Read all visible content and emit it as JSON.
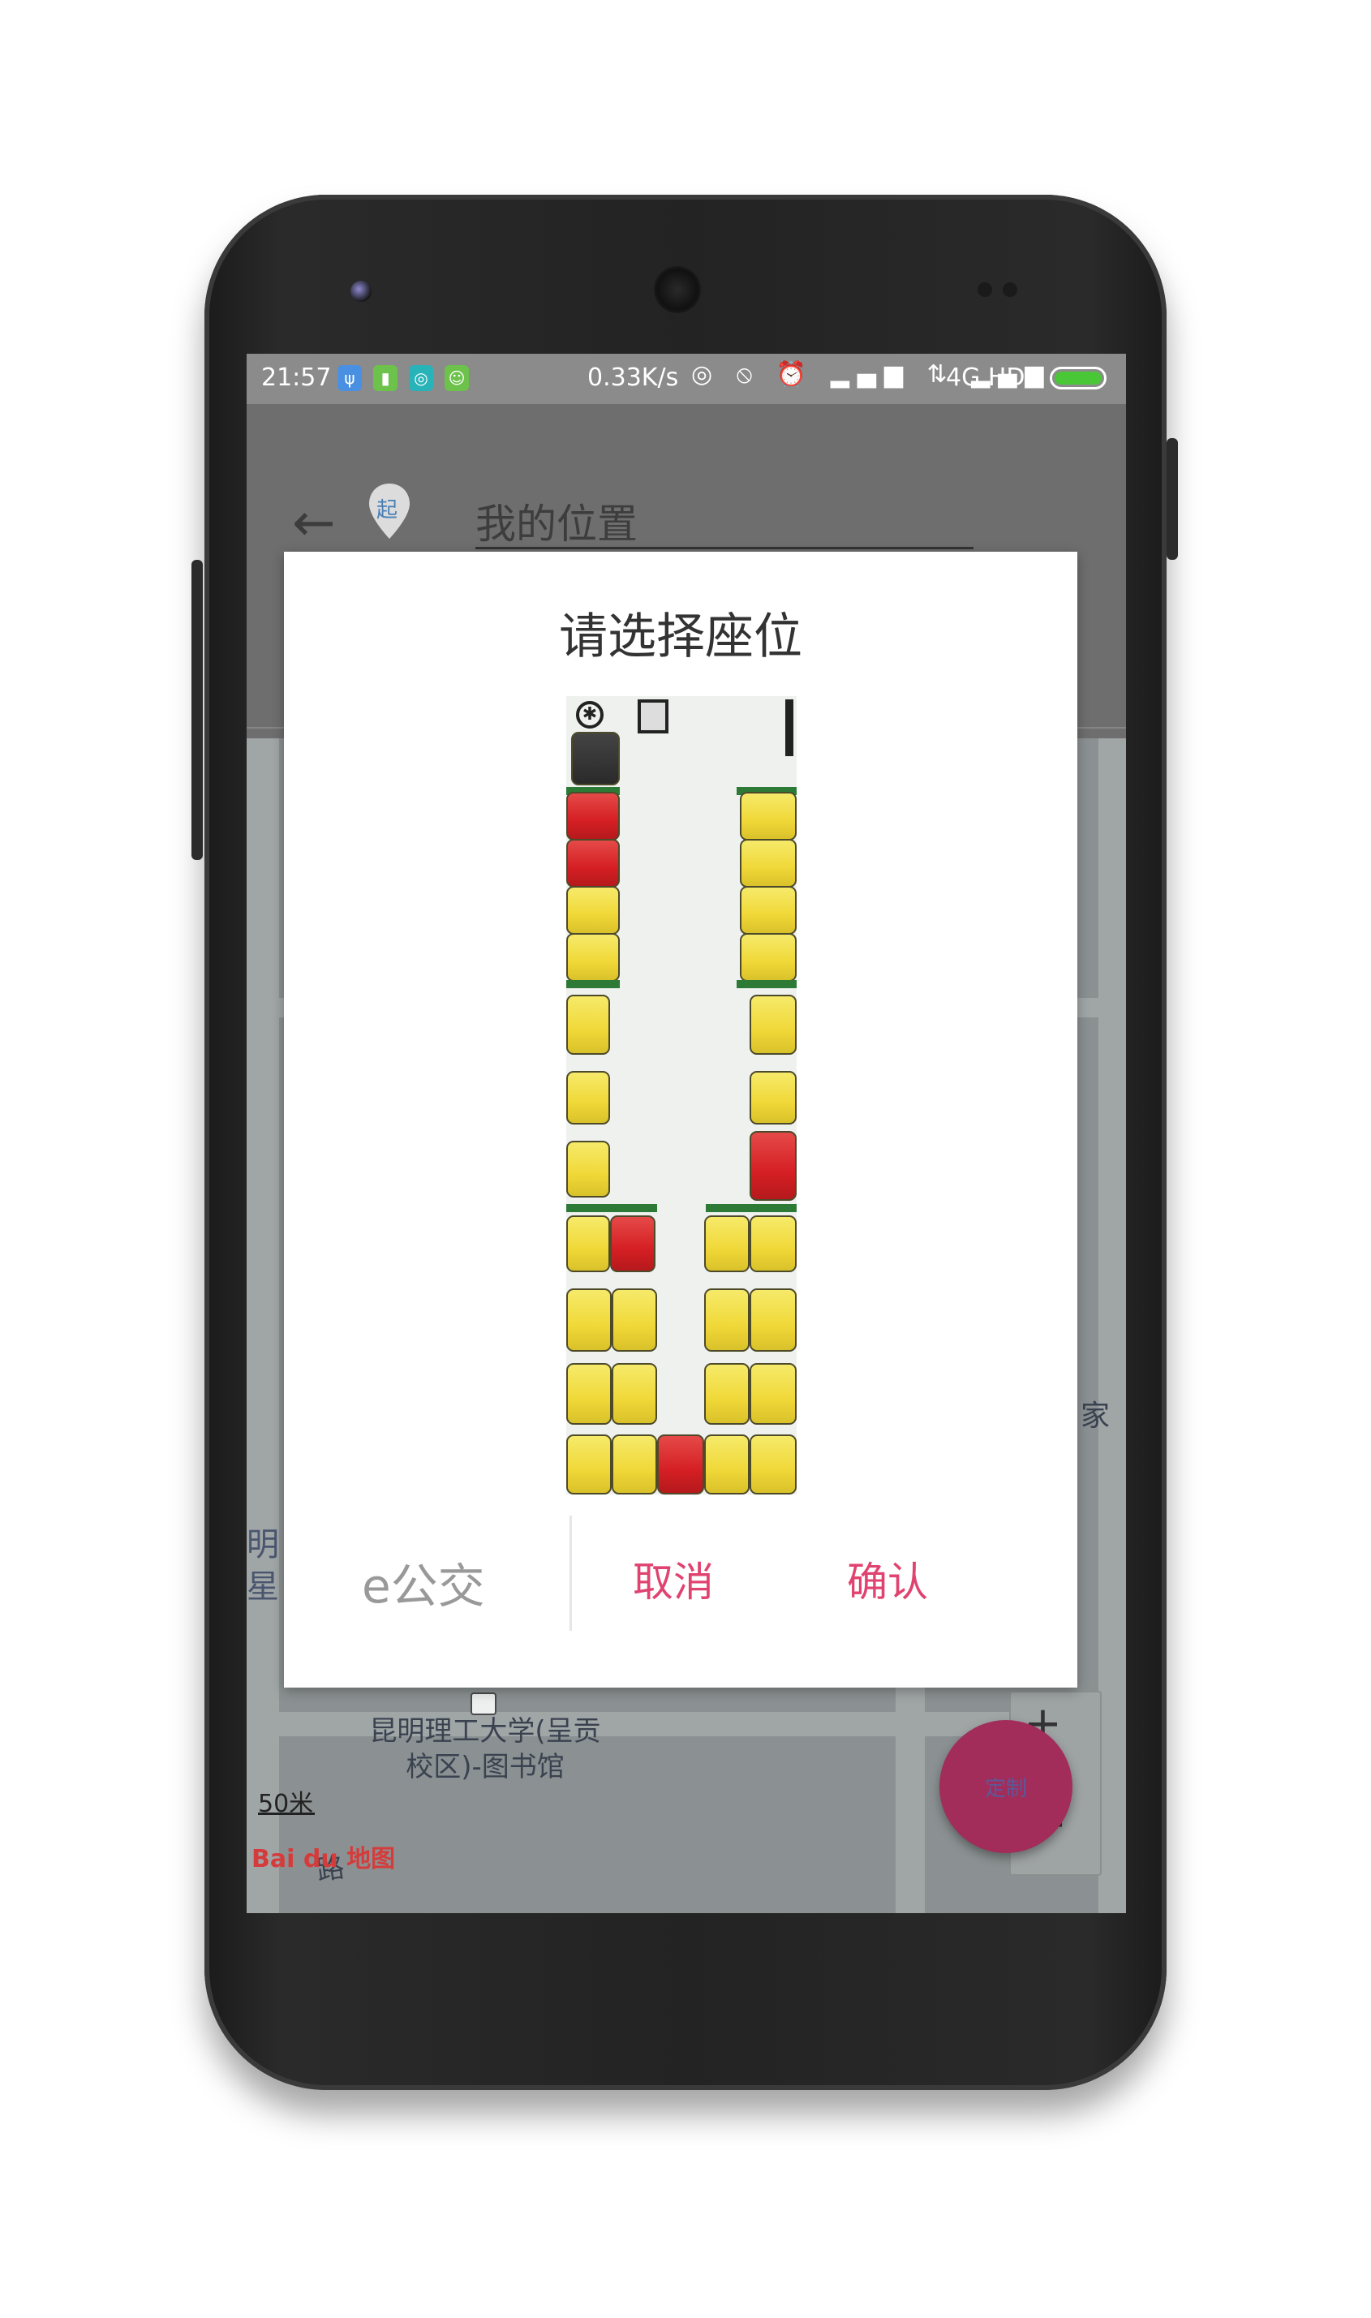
{
  "status_bar": {
    "time": "21:57",
    "speed": "0.33K/s",
    "network": "4G HD",
    "status_glyphs": "◎ ⦸ ⏰ ▂▄▆ ⇅ ▂▄▆"
  },
  "header": {
    "origin_pin_label": "起",
    "origin_value": "我的位置"
  },
  "dialog": {
    "title": "请选择座位",
    "brand": "e公交",
    "cancel_label": "取消",
    "confirm_label": "确认"
  },
  "map": {
    "scale_label": "50米",
    "poi_library": "昆明理工大学(呈贡\n校区)-图书馆",
    "road_label": "路",
    "partial_label_right": "家",
    "partial_label_left": "明\n星",
    "baidu_logo": "Bai du 地图",
    "fab_label": "定制",
    "zoom_in": "+",
    "zoom_out": "−"
  },
  "colors": {
    "accent": "#e0436f",
    "fab": "#a22c5a",
    "seat_available": "#f0d838",
    "seat_taken": "#d51f24",
    "battery": "#49c736"
  },
  "seats_summary": {
    "available_color": "yellow",
    "occupied_color": "red"
  }
}
